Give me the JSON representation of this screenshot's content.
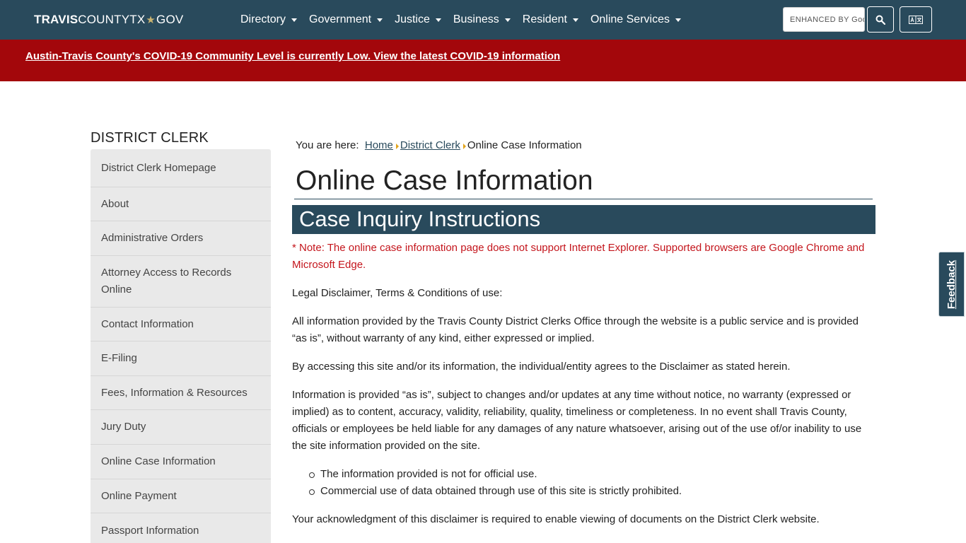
{
  "header": {
    "brand_bold": "TRAVIS",
    "brand_rest": "COUNTYTX",
    "brand_star": "★",
    "brand_gov": "GOV",
    "nav": [
      {
        "label": "Directory"
      },
      {
        "label": "Government"
      },
      {
        "label": "Justice"
      },
      {
        "label": "Business"
      },
      {
        "label": "Resident"
      },
      {
        "label": "Online Services"
      }
    ],
    "search_placeholder": "ENHANCED BY Google",
    "search_icon": "search-icon",
    "translate_icon": "translate-icon"
  },
  "alert": {
    "text": "Austin-Travis County's COVID-19 Community Level is currently Low. View the latest COVID-19 information"
  },
  "sidebar": {
    "title": "DISTRICT CLERK",
    "items": [
      {
        "label": "District Clerk Homepage"
      },
      {
        "label": "About"
      },
      {
        "label": "Administrative Orders"
      },
      {
        "label": "Attorney Access to Records Online"
      },
      {
        "label": "Contact Information"
      },
      {
        "label": "E-Filing"
      },
      {
        "label": "Fees, Information & Resources"
      },
      {
        "label": "Jury Duty"
      },
      {
        "label": "Online Case Information"
      },
      {
        "label": "Online Payment"
      },
      {
        "label": "Passport Information"
      }
    ]
  },
  "breadcrumb": {
    "prefix": "You are here:",
    "home": "Home",
    "parent": "District Clerk",
    "current": "Online Case Information"
  },
  "main": {
    "title": "Online Case Information",
    "section_title": "Case Inquiry Instructions",
    "note": "* Note: The online case information page does not support Internet Explorer. Supported browsers are Google Chrome and Microsoft Edge.",
    "p1": "Legal Disclaimer, Terms & Conditions of use:",
    "p2": "All information provided by the Travis County District Clerks Office through the website is a public service and is provided “as is”, without warranty of any kind, either expressed or implied.",
    "p3": "By accessing this site and/or its information, the individual/entity agrees to the Disclaimer as stated herein.",
    "p4": "Information is provided “as is”, subject to changes and/or updates at any time without notice, no warranty (expressed or implied) as to content, accuracy, validity, reliability, quality, timeliness or completeness. In no event shall Travis County, officials or employees be held liable for any damages of any nature whatsoever, arising out of the use of/or inability to use the site information provided on the site.",
    "bullets": [
      "The information provided is not for official use.",
      "Commercial use of data obtained through use of this site is strictly prohibited."
    ],
    "p5": "Your acknowledgment of this disclaimer is required to enable viewing of documents on the District Clerk website."
  },
  "feedback": {
    "label": "Feedback"
  },
  "colors": {
    "navbar": "#294a5c",
    "alert": "#a3070b",
    "note": "#c4151c",
    "breadcrumb_arrow": "#e2a41c"
  }
}
